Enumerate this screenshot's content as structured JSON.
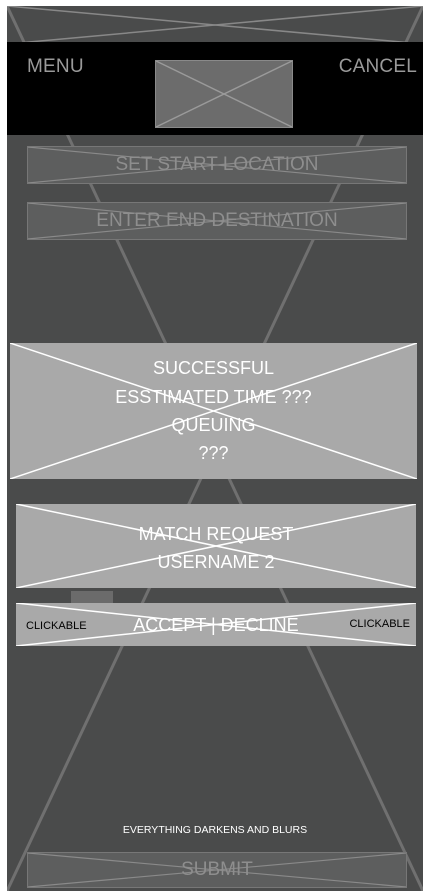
{
  "header": {
    "menu_label": "MENU",
    "cancel_label": "CANCEL"
  },
  "form": {
    "start_label": "SET START LOCATION",
    "end_label": "ENTER END DESTINATION",
    "submit_label": "SUBMIT"
  },
  "status": {
    "line1": "SUCCESSFUL",
    "line2": "ESSTIMATED TIME ???",
    "line3": "QUEUING",
    "line4": "???"
  },
  "match": {
    "line1": "MATCH REQUEST",
    "line2": "USERNAME 2"
  },
  "actions": {
    "center_label": "ACCEPT | DECLINE",
    "left_note": "CLICKABLE",
    "right_note": "CLICKABLE"
  },
  "overlay_note": "EVERYTHING DARKENS AND BLURS"
}
